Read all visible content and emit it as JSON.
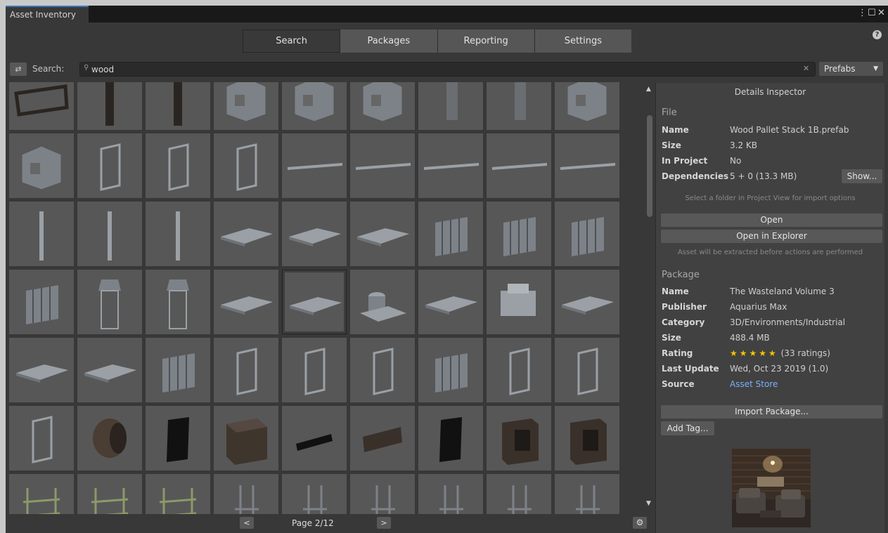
{
  "window": {
    "tab_title": "Asset Inventory"
  },
  "nav": {
    "tabs": [
      "Search",
      "Packages",
      "Reporting",
      "Settings"
    ],
    "active": 0
  },
  "search": {
    "label": "Search:",
    "query": "wood",
    "type_filter": "Prefabs"
  },
  "grid": {
    "columns": 9,
    "tile_count": 63,
    "selected_index": 31
  },
  "pager": {
    "prev": "<",
    "next": ">",
    "page_text": "Page 2/12"
  },
  "details": {
    "title": "Details Inspector",
    "file": {
      "section": "File",
      "name_label": "Name",
      "name": "Wood Pallet Stack 1B.prefab",
      "size_label": "Size",
      "size": "3.2 KB",
      "inproject_label": "In Project",
      "inproject": "No",
      "deps_label": "Dependencies",
      "deps": "5 + 0 (13.3 MB)",
      "show_button": "Show...",
      "folder_hint": "Select a folder in Project View for import options",
      "open_button": "Open",
      "explorer_button": "Open in Explorer",
      "extract_hint": "Asset will be extracted before actions are performed"
    },
    "package": {
      "section": "Package",
      "name_label": "Name",
      "name": "The Wasteland Volume 3",
      "publisher_label": "Publisher",
      "publisher": "Aquarius Max",
      "category_label": "Category",
      "category": "3D/Environments/Industrial",
      "size_label": "Size",
      "size": "488.4 MB",
      "rating_label": "Rating",
      "rating": 5,
      "rating_stars": "★★★★★",
      "rating_count": "(33 ratings)",
      "lastupdate_label": "Last Update",
      "lastupdate": "Wed, Oct 23 2019 (1.0)",
      "source_label": "Source",
      "source": "Asset Store",
      "import_button": "Import Package...",
      "addtag_button": "Add Tag..."
    }
  },
  "icons": [
    "filter-icon",
    "search-icon",
    "clear-icon",
    "dropdown-arrow-icon",
    "help-icon",
    "menu-dots-icon",
    "maximize-icon",
    "close-icon",
    "scroll-up-icon",
    "scroll-down-icon",
    "gear-icon",
    "star-icon"
  ],
  "colors": {
    "window_bg": "#383838",
    "tab_accent": "#3a79bb",
    "tile_bg": "#575757",
    "panel_bg": "#414141",
    "link": "#7ab0ff",
    "star": "#f2c200"
  }
}
